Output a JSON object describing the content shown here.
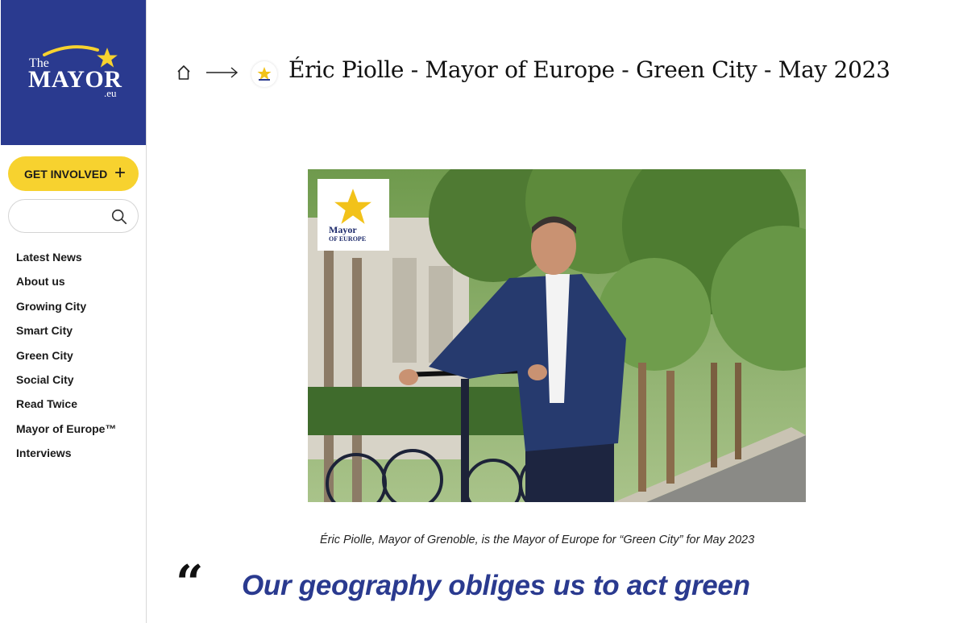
{
  "logo": {
    "the": "The",
    "mayor": "MAYOR",
    "eu": ".eu"
  },
  "get_involved": {
    "label": "GET INVOLVED",
    "icon": "plus-icon"
  },
  "search": {
    "placeholder": "",
    "icon": "search-icon"
  },
  "nav": {
    "items": [
      {
        "label": "Latest News"
      },
      {
        "label": "About us"
      },
      {
        "label": "Growing City"
      },
      {
        "label": "Smart City"
      },
      {
        "label": "Green City"
      },
      {
        "label": "Social City"
      },
      {
        "label": "Read Twice"
      },
      {
        "label": "Mayor of Europe™"
      },
      {
        "label": "Interviews"
      }
    ]
  },
  "breadcrumb": {
    "home_icon": "home-icon",
    "separator_icon": "arrow-right-icon"
  },
  "page": {
    "title": "Éric Piolle - Mayor of Europe - Green City - May 2023",
    "hero_badge": {
      "line1": "Mayor",
      "line2": "OF EUROPE"
    },
    "caption": "Éric Piolle, Mayor of Grenoble, is the Mayor of Europe  for “Green City” for May 2023",
    "quote_mark": "“",
    "quote": "Our geography obliges us to act green"
  },
  "colors": {
    "brand_blue": "#2a3a8f",
    "accent_yellow": "#f7d22f"
  }
}
